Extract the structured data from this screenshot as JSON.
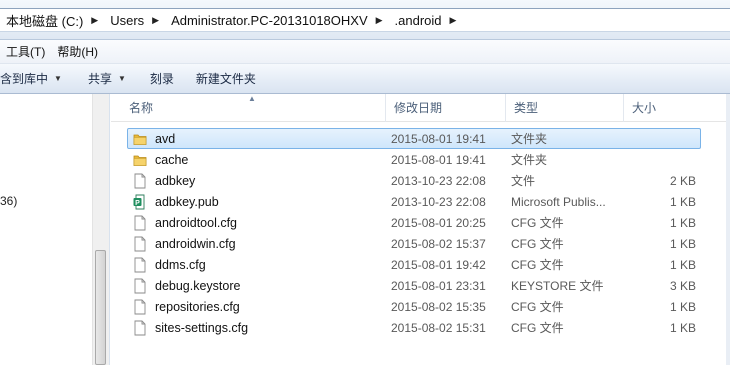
{
  "address": {
    "crumbs": [
      "本地磁盘 (C:)",
      "Users",
      "Administrator.PC-20131018OHXV",
      ".android"
    ]
  },
  "menubar": {
    "items": [
      "工具(T)",
      "帮助(H)"
    ]
  },
  "commandbar": {
    "include_label": "包含到库中",
    "share_label": "共享",
    "burn_label": "刻录",
    "newfolder_label": "新建文件夹"
  },
  "navpane": {
    "fragment": "36)"
  },
  "columns": {
    "name": "名称",
    "date": "修改日期",
    "type": "类型",
    "size": "大小"
  },
  "files": [
    {
      "name": "avd",
      "date": "2015-08-01 19:41",
      "type": "文件夹",
      "size": "",
      "icon": "folder-icon",
      "selected": true
    },
    {
      "name": "cache",
      "date": "2015-08-01 19:41",
      "type": "文件夹",
      "size": "",
      "icon": "folder-icon"
    },
    {
      "name": "adbkey",
      "date": "2013-10-23 22:08",
      "type": "文件",
      "size": "2 KB",
      "icon": "file-icon"
    },
    {
      "name": "adbkey.pub",
      "date": "2013-10-23 22:08",
      "type": "Microsoft Publis...",
      "size": "1 KB",
      "icon": "publisher-icon"
    },
    {
      "name": "androidtool.cfg",
      "date": "2015-08-01 20:25",
      "type": "CFG 文件",
      "size": "1 KB",
      "icon": "file-icon"
    },
    {
      "name": "androidwin.cfg",
      "date": "2015-08-02 15:37",
      "type": "CFG 文件",
      "size": "1 KB",
      "icon": "file-icon"
    },
    {
      "name": "ddms.cfg",
      "date": "2015-08-01 19:42",
      "type": "CFG 文件",
      "size": "1 KB",
      "icon": "file-icon"
    },
    {
      "name": "debug.keystore",
      "date": "2015-08-01 23:31",
      "type": "KEYSTORE 文件",
      "size": "3 KB",
      "icon": "file-icon"
    },
    {
      "name": "repositories.cfg",
      "date": "2015-08-02 15:35",
      "type": "CFG 文件",
      "size": "1 KB",
      "icon": "file-icon"
    },
    {
      "name": "sites-settings.cfg",
      "date": "2015-08-02 15:31",
      "type": "CFG 文件",
      "size": "1 KB",
      "icon": "file-icon"
    }
  ]
}
